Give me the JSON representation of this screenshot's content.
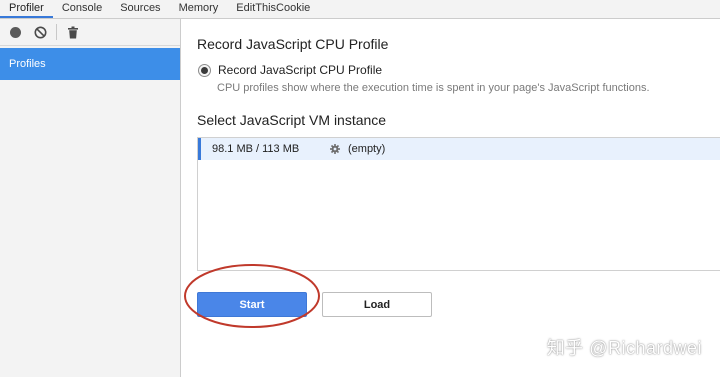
{
  "tabs": [
    {
      "label": "Profiler",
      "active": true
    },
    {
      "label": "Console",
      "active": false
    },
    {
      "label": "Sources",
      "active": false
    },
    {
      "label": "Memory",
      "active": false
    },
    {
      "label": "EditThisCookie",
      "active": false
    }
  ],
  "toolbar": {
    "record_icon": "record-icon",
    "clear_icon": "clear-icon",
    "delete_icon": "trash-icon"
  },
  "sidebar": {
    "items": [
      {
        "label": "Profiles",
        "selected": true
      }
    ]
  },
  "main": {
    "profile_type_title": "Record JavaScript CPU Profile",
    "radio_label": "Record JavaScript CPU Profile",
    "radio_selected": true,
    "radio_description": "CPU profiles show where the execution time is spent in your page's JavaScript functions.",
    "vm_title": "Select JavaScript VM instance",
    "vm_instances": [
      {
        "memory": "98.1 MB / 113 MB",
        "status": "(empty)"
      }
    ],
    "start_label": "Start",
    "load_label": "Load"
  },
  "annotation": {
    "color": "#c0392b"
  },
  "watermark": "知乎 @Richardwei",
  "colors": {
    "accent": "#3879d9",
    "selected_sidebar": "#3d8ee8",
    "start_button": "#4a86e8"
  }
}
